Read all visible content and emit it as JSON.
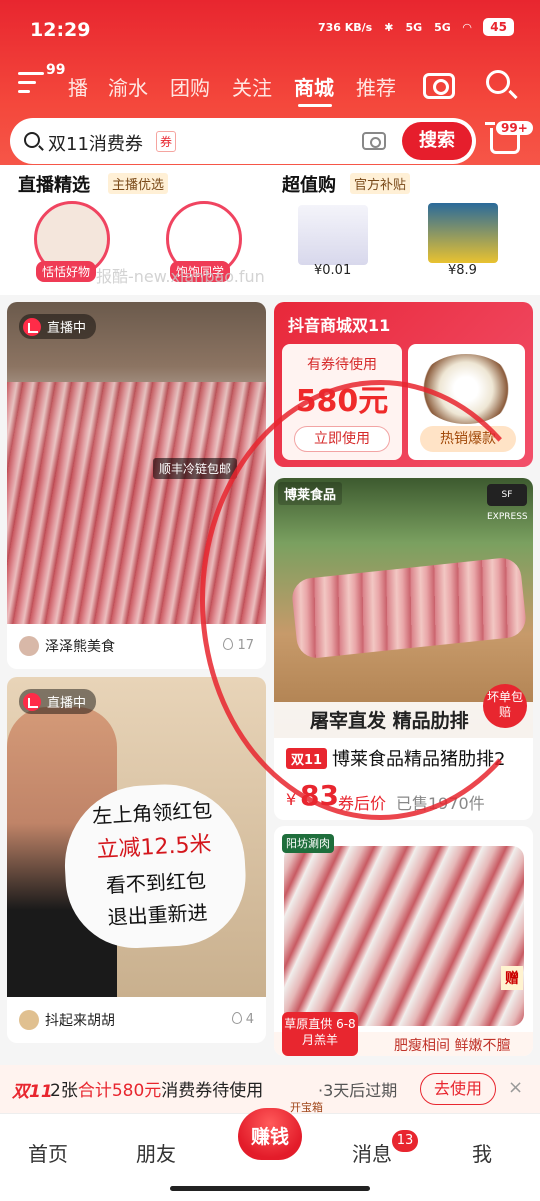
{
  "status_bar": {
    "time": "12:29",
    "net_speed": "736 KB/s",
    "signal1": "5G",
    "signal2": "5G",
    "battery": "45"
  },
  "nav": {
    "badge": "99",
    "tabs": [
      "播",
      "渝水",
      "团购",
      "关注",
      "商城",
      "推荐"
    ],
    "active_tab": "商城"
  },
  "search": {
    "query": "双11消费券",
    "coupon_tag": "券",
    "button": "搜索",
    "cart_badge": "99+"
  },
  "live_pick": {
    "title": "直播精选",
    "tag": "主播优选",
    "anchors": [
      "恬恬好物",
      "饱饱同学"
    ]
  },
  "value_buy": {
    "title": "超值购",
    "tag": "官方补贴",
    "prices": [
      "¥0.01",
      "¥8.9"
    ]
  },
  "watermark": "报酷-new.xianbao.fun",
  "feed_left": [
    {
      "live": "直播中",
      "sticker": "顺丰冷链包邮",
      "author": "泽泽熊美食",
      "likes": "17"
    },
    {
      "live": "直播中",
      "sign_lines": [
        "左上角领红包",
        "立减12.5米",
        "看不到红包",
        "退出重新进"
      ],
      "author": "抖起来胡胡",
      "likes": "4"
    }
  ],
  "promo": {
    "title": "抖音商城双11",
    "coupon_label": "有券待使用",
    "coupon_amount": "580元",
    "coupon_btn": "立即使用",
    "hot_btn": "热销爆款"
  },
  "product1": {
    "brand": "博莱食品",
    "express": "SF EXPRESS",
    "banner": "屠宰直发 精品肋排",
    "sticker": "坏单包赔",
    "tag": "双11",
    "name": "博莱食品精品猪肋排2",
    "price_symbol": "¥",
    "price": "83",
    "price_suffix": "券后价",
    "sold": "已售1970件"
  },
  "product2": {
    "brand_tag": "阳坊涮肉",
    "left_caption": "草原直供 6-8月羔羊",
    "right_caption": "肥瘦相间 鲜嫩不膻",
    "gift": "赠"
  },
  "coupon_banner": {
    "tag": "双11",
    "text_prefix": "2张",
    "text_highlight": "合计580元",
    "text_suffix": "消费券待使用",
    "expire": "·3天后过期",
    "button": "去使用",
    "close": "×",
    "treasure": "开宝箱"
  },
  "tabbar": {
    "items": [
      "首页",
      "朋友",
      "赚钱",
      "消息",
      "我"
    ],
    "message_badge": "13"
  }
}
